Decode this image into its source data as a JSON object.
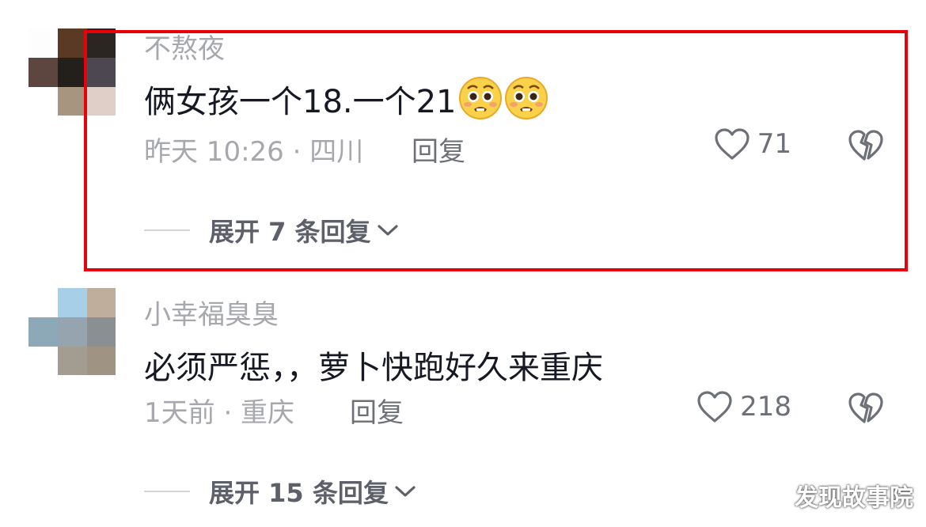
{
  "comments": [
    {
      "username": "不熬夜",
      "content": "俩女孩一个18.一个21",
      "emojis": [
        "pleading-face",
        "pleading-face"
      ],
      "time_location": "昨天 10:26 · 四川",
      "reply_label": "回复",
      "like_count": "71",
      "expand_label": "展开 7 条回复",
      "highlighted": true,
      "highlight_color": "#e8000b"
    },
    {
      "username": "小幸福臭臭",
      "content": "必须严惩，，萝卜快跑好久来重庆",
      "time_location": "1天前 · 重庆",
      "reply_label": "回复",
      "like_count": "218",
      "expand_label": "展开 15 条回复"
    }
  ],
  "watermark": "发现故事院",
  "colors": {
    "primary_text": "#161823",
    "secondary_text": "#a7a8ad",
    "action_text": "#6e7078",
    "highlight": "#e8000b"
  }
}
